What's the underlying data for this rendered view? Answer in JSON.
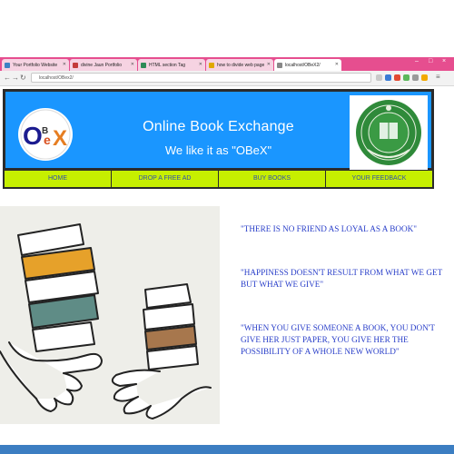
{
  "browser": {
    "tabs": [
      {
        "label": "Your Portfolio Website",
        "favicon_color": "#3b82c4"
      },
      {
        "label": "divine Jaun Portfolio",
        "favicon_color": "#c43b3b"
      },
      {
        "label": "HTML section Tag",
        "favicon_color": "#2e8b57"
      },
      {
        "label": "how to divide web page",
        "favicon_color": "#e0a800"
      },
      {
        "label": "localhost/OBeX2/",
        "favicon_color": "#888888",
        "active": true
      }
    ],
    "address": "localhost/OBex2/",
    "window_controls": [
      "–",
      "□",
      "×"
    ]
  },
  "site": {
    "logo_text": "OBeX",
    "title": "Online Book Exchange",
    "tagline": "We like it as \"OBeX\"",
    "nav": [
      "HOME",
      "DROP A FREE Ad",
      "BUY BOOKS",
      "YOUR FEEDBACK"
    ],
    "quotes": [
      "\"THERE IS NO FRIEND AS LOYAL AS A BOOK\"",
      "\"HAPPINESS DOESN'T RESULT FROM WHAT WE GET BUT WHAT WE GIVE\"",
      "\"WHEN YOU GIVE SOMEONE A BOOK, YOU DON'T GIVE HER JUST PAPER, YOU GIVE HER THE POSSIBILITY OF A WHOLE NEW WORLD\""
    ]
  },
  "colors": {
    "header_blue": "#1a96ff",
    "nav_lime": "#c6ef00",
    "quote_blue": "#2a3fc9",
    "tabstrip_pink": "#e64e8f"
  }
}
